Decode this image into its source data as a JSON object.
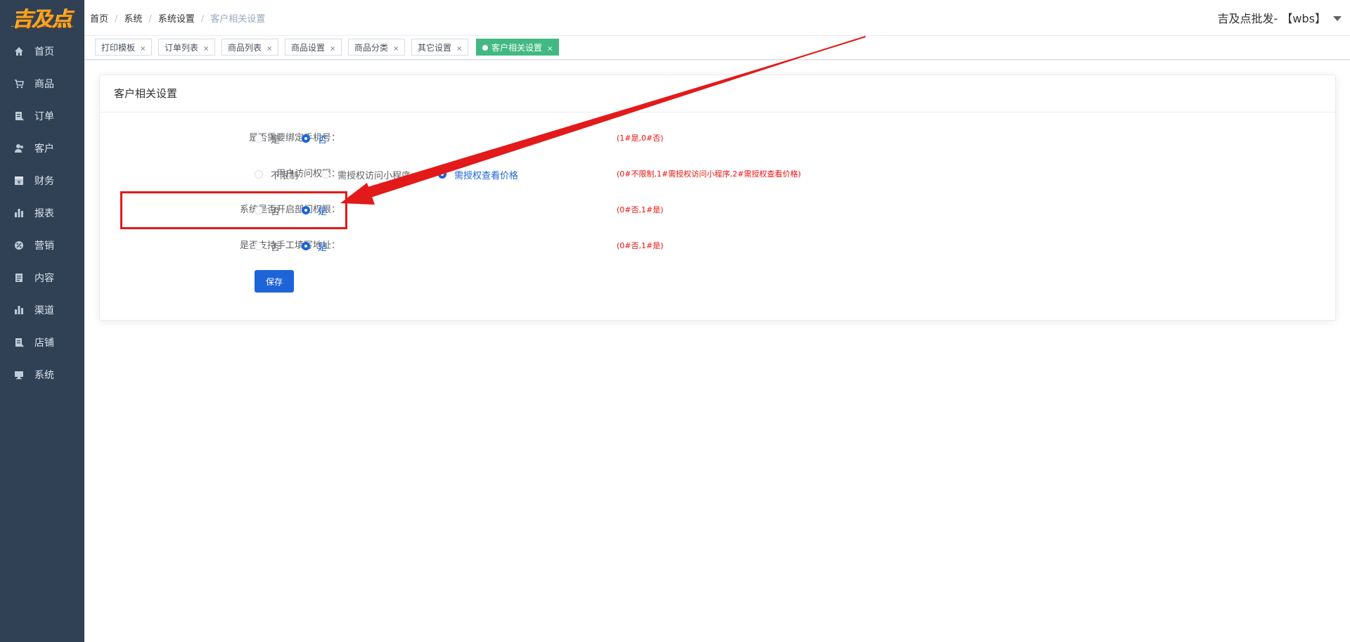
{
  "logo": {
    "text": "吉及点"
  },
  "sidebar": {
    "items": [
      {
        "label": "首页",
        "icon": "home-icon"
      },
      {
        "label": "商品",
        "icon": "cart-icon"
      },
      {
        "label": "订单",
        "icon": "order-icon"
      },
      {
        "label": "客户",
        "icon": "customer-icon"
      },
      {
        "label": "财务",
        "icon": "finance-icon"
      },
      {
        "label": "报表",
        "icon": "report-icon"
      },
      {
        "label": "营销",
        "icon": "marketing-icon"
      },
      {
        "label": "内容",
        "icon": "content-icon"
      },
      {
        "label": "渠道",
        "icon": "channel-icon"
      },
      {
        "label": "店铺",
        "icon": "store-icon"
      },
      {
        "label": "系统",
        "icon": "system-icon"
      }
    ]
  },
  "breadcrumb": {
    "items": [
      "首页",
      "系统",
      "系统设置",
      "客户相关设置"
    ],
    "separator": "/"
  },
  "user": {
    "name": "吉及点批发- 【wbs】"
  },
  "tags": [
    {
      "label": "打印模板",
      "active": false
    },
    {
      "label": "订单列表",
      "active": false
    },
    {
      "label": "商品列表",
      "active": false
    },
    {
      "label": "商品设置",
      "active": false
    },
    {
      "label": "商品分类",
      "active": false
    },
    {
      "label": "其它设置",
      "active": false
    },
    {
      "label": "客户相关设置",
      "active": true
    }
  ],
  "tag_close": "×",
  "card": {
    "title": "客户相关设置",
    "rows": [
      {
        "label": "是否需要绑定手机号：",
        "options": [
          {
            "label": "是",
            "checked": false
          },
          {
            "label": "否",
            "checked": true
          }
        ],
        "hint": "(1#是,0#否)"
      },
      {
        "label": "用户访问权限：",
        "options": [
          {
            "label": "不限制",
            "checked": false
          },
          {
            "label": "需授权访问小程序",
            "checked": false
          },
          {
            "label": "需授权查看价格",
            "checked": true
          }
        ],
        "hint": "(0#不限制,1#需授权访问小程序,2#需授权查看价格)"
      },
      {
        "label": "系统是否开启部门权限：",
        "options": [
          {
            "label": "否",
            "checked": false
          },
          {
            "label": "是",
            "checked": true
          }
        ],
        "hint": "(0#否,1#是)"
      },
      {
        "label": "是否支持手工填写地址：",
        "options": [
          {
            "label": "否",
            "checked": false
          },
          {
            "label": "是",
            "checked": true
          }
        ],
        "hint": "(0#否,1#是)"
      }
    ],
    "save_label": "保存"
  },
  "colors": {
    "sidebar_bg": "#304156",
    "accent_blue": "#1d64d8",
    "active_tag": "#42b983",
    "hint_red": "#ee1111",
    "annotation_red": "#e21a1a"
  }
}
